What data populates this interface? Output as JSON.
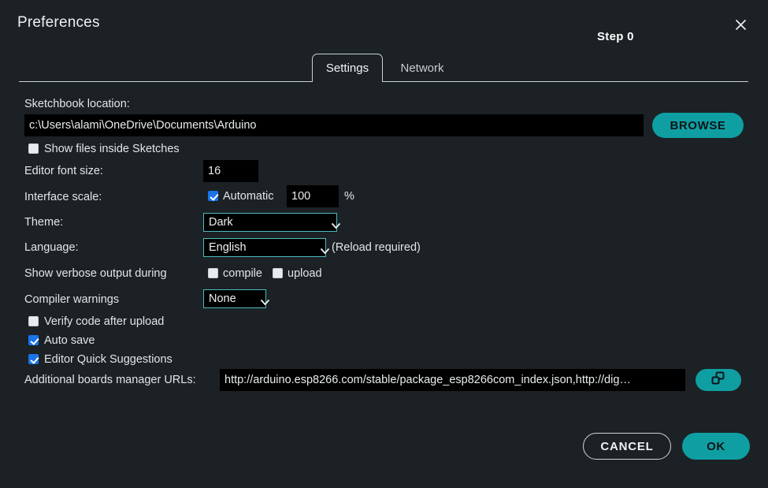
{
  "window": {
    "title": "Preferences",
    "step_label": "Step 0",
    "close_icon": "close-icon"
  },
  "tabs": [
    {
      "label": "Settings",
      "active": true
    },
    {
      "label": "Network",
      "active": false
    }
  ],
  "settings": {
    "sketchbook": {
      "label": "Sketchbook location:",
      "value": "c:\\Users\\alami\\OneDrive\\Documents\\Arduino",
      "browse_label": "BROWSE"
    },
    "show_files_inside_sketches": {
      "label": "Show files inside Sketches",
      "checked": false
    },
    "editor_font_size": {
      "label": "Editor font size:",
      "value": "16"
    },
    "interface_scale": {
      "label": "Interface scale:",
      "automatic_label": "Automatic",
      "automatic_checked": true,
      "value": "100",
      "unit": "%"
    },
    "theme": {
      "label": "Theme:",
      "value": "Dark",
      "options": [
        "Dark"
      ]
    },
    "language": {
      "label": "Language:",
      "value": "English",
      "options": [
        "English"
      ],
      "note": "(Reload required)"
    },
    "verbose_output": {
      "label": "Show verbose output during",
      "compile_label": "compile",
      "compile_checked": false,
      "upload_label": "upload",
      "upload_checked": false
    },
    "compiler_warnings": {
      "label": "Compiler warnings",
      "value": "None",
      "options": [
        "None"
      ]
    },
    "verify_code_after_upload": {
      "label": "Verify code after upload",
      "checked": false
    },
    "auto_save": {
      "label": "Auto save",
      "checked": true
    },
    "editor_quick_suggestions": {
      "label": "Editor Quick Suggestions",
      "checked": true
    },
    "additional_urls": {
      "label": "Additional boards manager URLs:",
      "value": "http://arduino.esp8266.com/stable/package_esp8266com_index.json,http://dig…",
      "expand_icon": "open-window-icon"
    }
  },
  "footer": {
    "cancel_label": "CANCEL",
    "ok_label": "OK"
  },
  "colors": {
    "background": "#1b2124",
    "field_background": "#000000",
    "accent_teal": "#0f9fa3",
    "combo_border": "#4fb9bd",
    "checkbox_blue": "#1a73e8",
    "text": "#e2e6e8"
  }
}
